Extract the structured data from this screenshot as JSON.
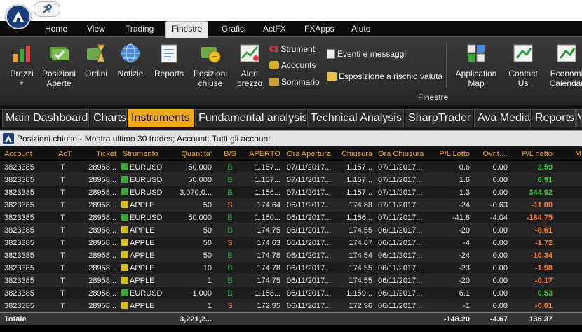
{
  "menu": {
    "items": [
      {
        "label": "Home"
      },
      {
        "label": "View"
      },
      {
        "label": "Trading"
      },
      {
        "label": "Finestre"
      },
      {
        "label": "Grafici"
      },
      {
        "label": "ActFX"
      },
      {
        "label": "FXApps"
      },
      {
        "label": "Aiuto"
      }
    ],
    "active_label": "Finestre"
  },
  "ribbon": {
    "buttons": [
      {
        "label": "Prezzi",
        "icon": "bar-chart-icon"
      },
      {
        "label": "Posizioni\nAperte",
        "icon": "money-check-icon"
      },
      {
        "label": "Ordini",
        "icon": "hourglass-icon"
      },
      {
        "label": "Notizie",
        "icon": "globe-icon"
      },
      {
        "label": "Reports",
        "icon": "report-icon"
      },
      {
        "label": "Posizioni\nchiuse",
        "icon": "money-closed-icon"
      },
      {
        "label": "Alert\nprezzo",
        "icon": "alert-chart-icon"
      }
    ],
    "small_buttons": [
      {
        "label": "Strumenti",
        "icon": "exchange-icon"
      },
      {
        "label": "Accounts",
        "icon": "coins-icon"
      },
      {
        "label": "Sommario",
        "icon": "summary-icon"
      },
      {
        "label": "Eventi e messaggi",
        "icon": "document-icon"
      },
      {
        "label": "Esposizione a rischio valuta",
        "icon": "risk-icon"
      }
    ],
    "right_buttons": [
      {
        "label": "Application\nMap",
        "icon": "app-map-icon"
      },
      {
        "label": "Contact\nUs",
        "icon": "contact-icon"
      },
      {
        "label": "Economi\nCalendar",
        "icon": "calendar-icon"
      }
    ],
    "group_label": "Finestre"
  },
  "tabs": [
    {
      "label": "Main Dashboard"
    },
    {
      "label": "Charts"
    },
    {
      "label": "Instruments"
    },
    {
      "label": "Fundamental analysis"
    },
    {
      "label": "Technical Analysis"
    },
    {
      "label": "SharpTrader"
    },
    {
      "label": "Ava Media"
    },
    {
      "label": "Reports"
    },
    {
      "label": "V"
    }
  ],
  "active_tab": "Instruments",
  "panel": {
    "title": "Posizioni chiuse - Mostra ultimo 30 trades; Account: Tutti gli account"
  },
  "table": {
    "columns": [
      "Account",
      "AcT",
      "Ticket",
      "Strumento",
      "Quantita'",
      "B/S",
      "APERTO",
      "Ora Apertura",
      "Chiusura",
      "Ora Chiusura",
      "P/L Lotto",
      "Ovnt....",
      "P/L netto",
      "M"
    ],
    "rows": [
      {
        "account": "3823385",
        "act": "T",
        "ticket": "28958...",
        "instrument": "EURUSD",
        "type": "fx",
        "qty": "50,000",
        "bs": "B",
        "open": "1.157...",
        "open_time": "07/11/2017...",
        "close": "1.157...",
        "close_time": "07/11/2017...",
        "pl_lot": "0.6",
        "ovnt": "0.00",
        "pl_net": "2.59",
        "sign": "pos"
      },
      {
        "account": "3823385",
        "act": "T",
        "ticket": "28958...",
        "instrument": "EURUSD",
        "type": "fx",
        "qty": "50,000",
        "bs": "B",
        "open": "1.157...",
        "open_time": "07/11/2017...",
        "close": "1.157...",
        "close_time": "07/11/2017...",
        "pl_lot": "1.6",
        "ovnt": "0.00",
        "pl_net": "6.91",
        "sign": "pos"
      },
      {
        "account": "3823385",
        "act": "T",
        "ticket": "28958...",
        "instrument": "EURUSD",
        "type": "fx",
        "qty": "3,070,0...",
        "bs": "B",
        "open": "1.156...",
        "open_time": "07/11/2017...",
        "close": "1.157...",
        "close_time": "07/11/2017...",
        "pl_lot": "1.3",
        "ovnt": "0.00",
        "pl_net": "344.92",
        "sign": "pos"
      },
      {
        "account": "3823385",
        "act": "T",
        "ticket": "28958...",
        "instrument": "APPLE",
        "type": "st",
        "qty": "50",
        "bs": "S",
        "open": "174.64",
        "open_time": "06/11/2017...",
        "close": "174.88",
        "close_time": "07/11/2017...",
        "pl_lot": "-24",
        "ovnt": "-0.63",
        "pl_net": "-11.00",
        "sign": "neg"
      },
      {
        "account": "3823385",
        "act": "T",
        "ticket": "28958...",
        "instrument": "EURUSD",
        "type": "fx",
        "qty": "50,000",
        "bs": "B",
        "open": "1.160...",
        "open_time": "06/11/2017...",
        "close": "1.156...",
        "close_time": "07/11/2017...",
        "pl_lot": "-41.8",
        "ovnt": "-4.04",
        "pl_net": "-184.75",
        "sign": "neg"
      },
      {
        "account": "3823385",
        "act": "T",
        "ticket": "28958...",
        "instrument": "APPLE",
        "type": "st",
        "qty": "50",
        "bs": "B",
        "open": "174.75",
        "open_time": "06/11/2017...",
        "close": "174.55",
        "close_time": "06/11/2017...",
        "pl_lot": "-20",
        "ovnt": "0.00",
        "pl_net": "-8.61",
        "sign": "neg"
      },
      {
        "account": "3823385",
        "act": "T",
        "ticket": "28958...",
        "instrument": "APPLE",
        "type": "st",
        "qty": "50",
        "bs": "S",
        "open": "174.63",
        "open_time": "06/11/2017...",
        "close": "174.67",
        "close_time": "06/11/2017...",
        "pl_lot": "-4",
        "ovnt": "0.00",
        "pl_net": "-1.72",
        "sign": "neg"
      },
      {
        "account": "3823385",
        "act": "T",
        "ticket": "28958...",
        "instrument": "APPLE",
        "type": "st",
        "qty": "50",
        "bs": "B",
        "open": "174.78",
        "open_time": "06/11/2017...",
        "close": "174.54",
        "close_time": "06/11/2017...",
        "pl_lot": "-24",
        "ovnt": "0.00",
        "pl_net": "-10.34",
        "sign": "neg"
      },
      {
        "account": "3823385",
        "act": "T",
        "ticket": "28958...",
        "instrument": "APPLE",
        "type": "st",
        "qty": "10",
        "bs": "B",
        "open": "174.78",
        "open_time": "06/11/2017...",
        "close": "174.55",
        "close_time": "06/11/2017...",
        "pl_lot": "-23",
        "ovnt": "0.00",
        "pl_net": "-1.98",
        "sign": "neg"
      },
      {
        "account": "3823385",
        "act": "T",
        "ticket": "28958...",
        "instrument": "APPLE",
        "type": "st",
        "qty": "1",
        "bs": "B",
        "open": "174.75",
        "open_time": "06/11/2017...",
        "close": "174.55",
        "close_time": "06/11/2017...",
        "pl_lot": "-20",
        "ovnt": "0.00",
        "pl_net": "-0.17",
        "sign": "neg"
      },
      {
        "account": "3823385",
        "act": "T",
        "ticket": "28958...",
        "instrument": "EURUSD",
        "type": "fx",
        "qty": "1,000",
        "bs": "B",
        "open": "1.158...",
        "open_time": "06/11/2017...",
        "close": "1.159...",
        "close_time": "06/11/2017...",
        "pl_lot": "6.1",
        "ovnt": "0.00",
        "pl_net": "0.53",
        "sign": "pos"
      },
      {
        "account": "3823385",
        "act": "T",
        "ticket": "28958...",
        "instrument": "APPLE",
        "type": "st",
        "qty": "1",
        "bs": "S",
        "open": "172.95",
        "open_time": "06/11/2017...",
        "close": "172.96",
        "close_time": "06/11/2017...",
        "pl_lot": "-1",
        "ovnt": "0.00",
        "pl_net": "-0.01",
        "sign": "neg"
      }
    ],
    "total": {
      "label": "Totale",
      "qty": "3,221,2...",
      "pl_lot": "-148.20",
      "ovnt": "-4.67",
      "pl_net": "136.37"
    }
  },
  "colors": {
    "accent": "#f2a81d",
    "positive": "#3cc83c",
    "negative": "#ff7a2a",
    "header_text": "#f0a020"
  }
}
